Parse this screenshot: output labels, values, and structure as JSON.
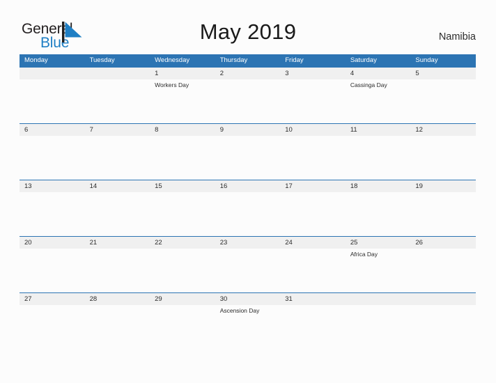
{
  "brand": {
    "name_part1": "General",
    "name_part2": "Blue",
    "flag_icon": "blue-triangle-flag-icon",
    "primary_color": "#1F7FC4",
    "text_color": "#231F20"
  },
  "header": {
    "title": "May 2019",
    "country": "Namibia"
  },
  "theme": {
    "header_blue": "#2C74B3",
    "row_border_blue": "#2C74B3",
    "band_gray": "#F0F0F0",
    "page_background": "#FCFCFC"
  },
  "calendar": {
    "weekdays": [
      "Monday",
      "Tuesday",
      "Wednesday",
      "Thursday",
      "Friday",
      "Saturday",
      "Sunday"
    ],
    "weeks": [
      [
        {
          "date": "",
          "event": ""
        },
        {
          "date": "",
          "event": ""
        },
        {
          "date": "1",
          "event": "Workers Day"
        },
        {
          "date": "2",
          "event": ""
        },
        {
          "date": "3",
          "event": ""
        },
        {
          "date": "4",
          "event": "Cassinga Day"
        },
        {
          "date": "5",
          "event": ""
        }
      ],
      [
        {
          "date": "6",
          "event": ""
        },
        {
          "date": "7",
          "event": ""
        },
        {
          "date": "8",
          "event": ""
        },
        {
          "date": "9",
          "event": ""
        },
        {
          "date": "10",
          "event": ""
        },
        {
          "date": "11",
          "event": ""
        },
        {
          "date": "12",
          "event": ""
        }
      ],
      [
        {
          "date": "13",
          "event": ""
        },
        {
          "date": "14",
          "event": ""
        },
        {
          "date": "15",
          "event": ""
        },
        {
          "date": "16",
          "event": ""
        },
        {
          "date": "17",
          "event": ""
        },
        {
          "date": "18",
          "event": ""
        },
        {
          "date": "19",
          "event": ""
        }
      ],
      [
        {
          "date": "20",
          "event": ""
        },
        {
          "date": "21",
          "event": ""
        },
        {
          "date": "22",
          "event": ""
        },
        {
          "date": "23",
          "event": ""
        },
        {
          "date": "24",
          "event": ""
        },
        {
          "date": "25",
          "event": "Africa Day"
        },
        {
          "date": "26",
          "event": ""
        }
      ],
      [
        {
          "date": "27",
          "event": ""
        },
        {
          "date": "28",
          "event": ""
        },
        {
          "date": "29",
          "event": ""
        },
        {
          "date": "30",
          "event": "Ascension Day"
        },
        {
          "date": "31",
          "event": ""
        },
        {
          "date": "",
          "event": ""
        },
        {
          "date": "",
          "event": ""
        }
      ]
    ]
  }
}
